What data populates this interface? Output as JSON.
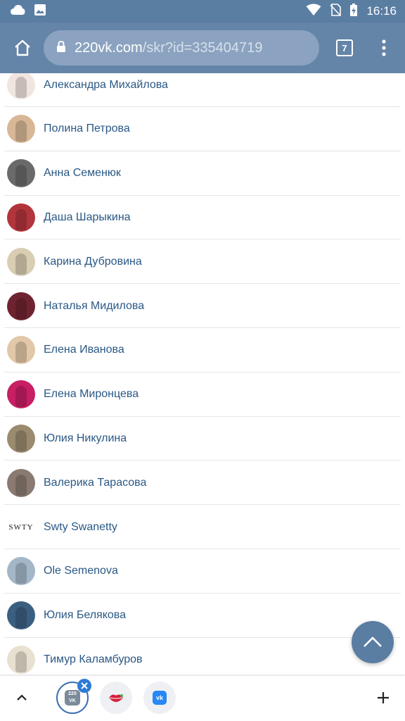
{
  "status_bar": {
    "time": "16:16",
    "icons": [
      "cloud-icon",
      "image-icon",
      "wifi-icon",
      "no-sim-icon",
      "battery-charging-icon"
    ]
  },
  "browser": {
    "url_host": "220vk.com",
    "url_path": "/skr?id=335404719",
    "tab_count": "7"
  },
  "friends": [
    {
      "name": "Александра Михайлова",
      "avatar_color": "#f1e6df"
    },
    {
      "name": "Полина Петрова",
      "avatar_color": "#d7b796"
    },
    {
      "name": "Анна Семенюк",
      "avatar_color": "#6a6a6a"
    },
    {
      "name": "Даша Шарыкина",
      "avatar_color": "#b2343c"
    },
    {
      "name": "Карина Дубровина",
      "avatar_color": "#d9cdb3"
    },
    {
      "name": "Наталья Мидилова",
      "avatar_color": "#6e2430"
    },
    {
      "name": "Елена Иванова",
      "avatar_color": "#e2c8a8"
    },
    {
      "name": "Елена Миронцева",
      "avatar_color": "#c81e63"
    },
    {
      "name": "Юлия Никулина",
      "avatar_color": "#9a8a6e"
    },
    {
      "name": "Валерика Тарасова",
      "avatar_color": "#8a7a72"
    },
    {
      "name": "Swty Swanetty",
      "avatar_color": "#ffffff",
      "avatar_text": "SWTY"
    },
    {
      "name": "Ole Semenova",
      "avatar_color": "#a4b7c8"
    },
    {
      "name": "Юлия Белякова",
      "avatar_color": "#3b5f80"
    },
    {
      "name": "Тимур Каламбуров",
      "avatar_color": "#e8e0d0"
    }
  ],
  "bottom_bar": {
    "app1_label": "220 VK",
    "app3_label": "vk"
  },
  "colors": {
    "status_bar": "#5a7da2",
    "toolbar": "#6484a8",
    "link": "#2a5885"
  }
}
